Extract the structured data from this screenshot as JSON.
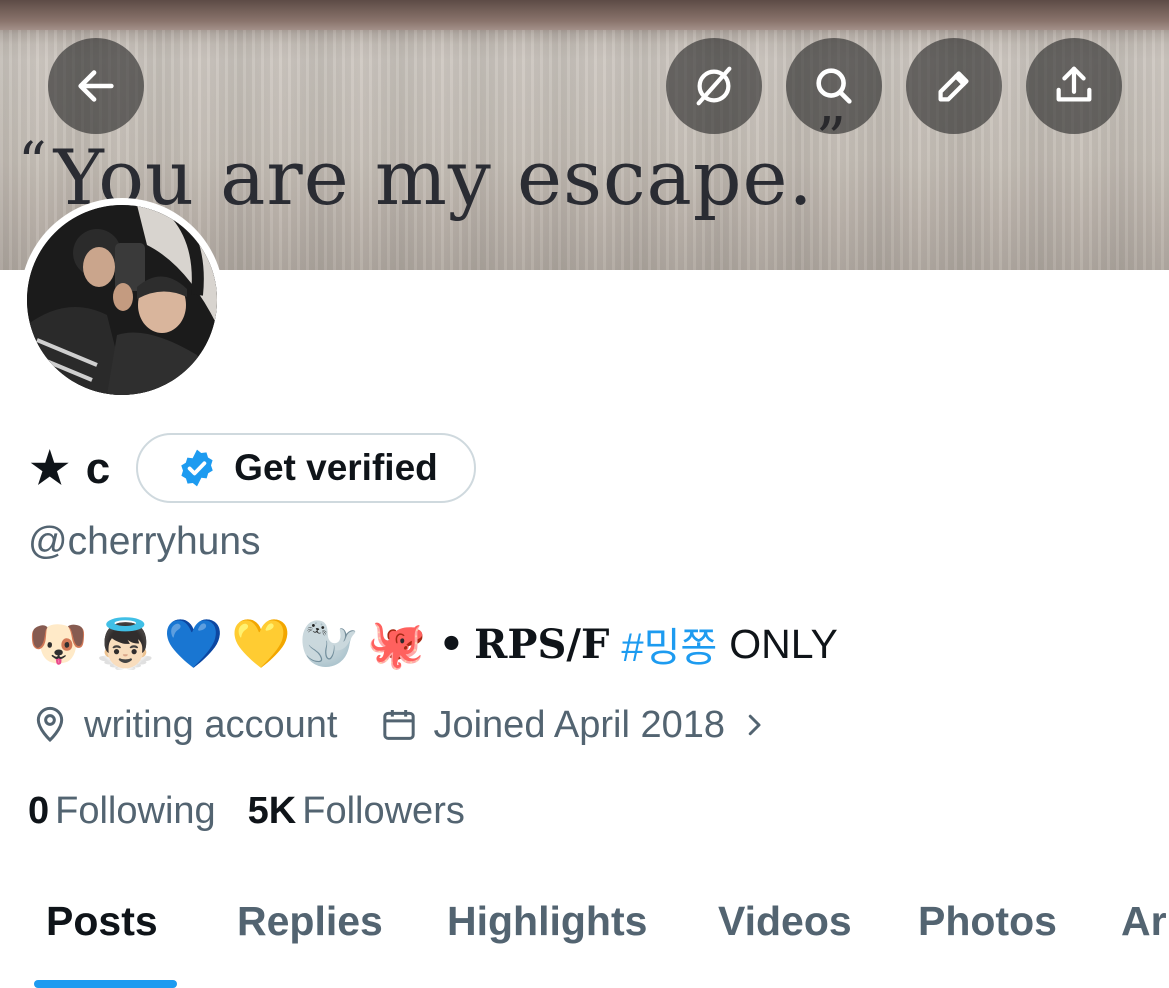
{
  "banner": {
    "quote_open": "“",
    "quote_text": "You are my escape.",
    "quote_close": "”"
  },
  "header_buttons": {
    "back": "back-arrow-icon",
    "translate": "globe-slash-icon",
    "search": "search-icon",
    "edit": "pencil-icon",
    "share": "share-icon"
  },
  "profile": {
    "star": "★",
    "name": "c",
    "verify_label": "Get verified",
    "handle": "@cherryhuns",
    "bio": {
      "emojis": [
        "🐶",
        "👼🏻",
        "💙",
        "💛",
        "🦭",
        "🐙"
      ],
      "separator": "•",
      "rps": "RPS/F",
      "hashtag": "#밍쫑",
      "only": "ONLY"
    },
    "location": "writing account",
    "joined": "Joined April 2018",
    "following_count": "0",
    "following_label": "Following",
    "followers_count": "5K",
    "followers_label": "Followers"
  },
  "tabs": [
    {
      "label": "Posts",
      "active": true
    },
    {
      "label": "Replies",
      "active": false
    },
    {
      "label": "Highlights",
      "active": false
    },
    {
      "label": "Videos",
      "active": false
    },
    {
      "label": "Photos",
      "active": false
    },
    {
      "label": "Ar",
      "active": false
    }
  ],
  "colors": {
    "accent": "#1d9bf0",
    "text_primary": "#0f1419",
    "text_secondary": "#536471",
    "border": "#cfd9de"
  }
}
